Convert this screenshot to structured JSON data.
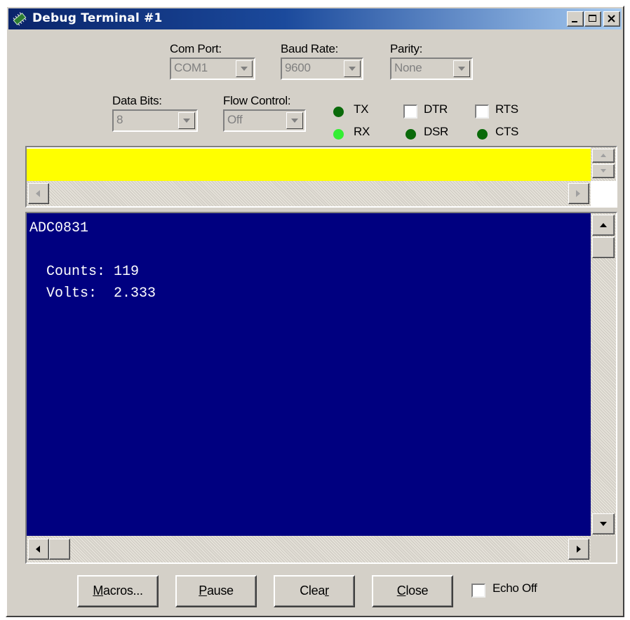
{
  "window": {
    "title": "Debug Terminal #1",
    "accent": "#0a246a"
  },
  "settings": {
    "com_port": {
      "label": "Com Port:",
      "value": "COM1"
    },
    "baud_rate": {
      "label": "Baud Rate:",
      "value": "9600"
    },
    "parity": {
      "label": "Parity:",
      "value": "None"
    },
    "data_bits": {
      "label": "Data Bits:",
      "value": "8"
    },
    "flow_control": {
      "label": "Flow Control:",
      "value": "Off"
    }
  },
  "indicators": {
    "tx": {
      "label": "TX",
      "color": "#0a6a0a"
    },
    "rx": {
      "label": "RX",
      "color": "#33ee33"
    },
    "dsr": {
      "label": "DSR",
      "color": "#0a6a0a"
    },
    "cts": {
      "label": "CTS",
      "color": "#0a6a0a"
    },
    "dtr": {
      "label": "DTR",
      "checked": false
    },
    "rts": {
      "label": "RTS",
      "checked": false
    }
  },
  "transmit_pane": {
    "color": "#ffff00"
  },
  "receive_pane": {
    "color": "#000080",
    "lines": [
      "ADC0831",
      "",
      "  Counts: 119",
      "  Volts:  2.333"
    ]
  },
  "buttons": {
    "macros": {
      "pre": "",
      "accel": "M",
      "post": "acros..."
    },
    "pause": {
      "pre": "",
      "accel": "P",
      "post": "ause"
    },
    "clear": {
      "pre": "Clea",
      "accel": "r",
      "post": ""
    },
    "close": {
      "pre": "",
      "accel": "C",
      "post": "lose"
    }
  },
  "echo_off": {
    "label": "Echo Off",
    "checked": false
  }
}
